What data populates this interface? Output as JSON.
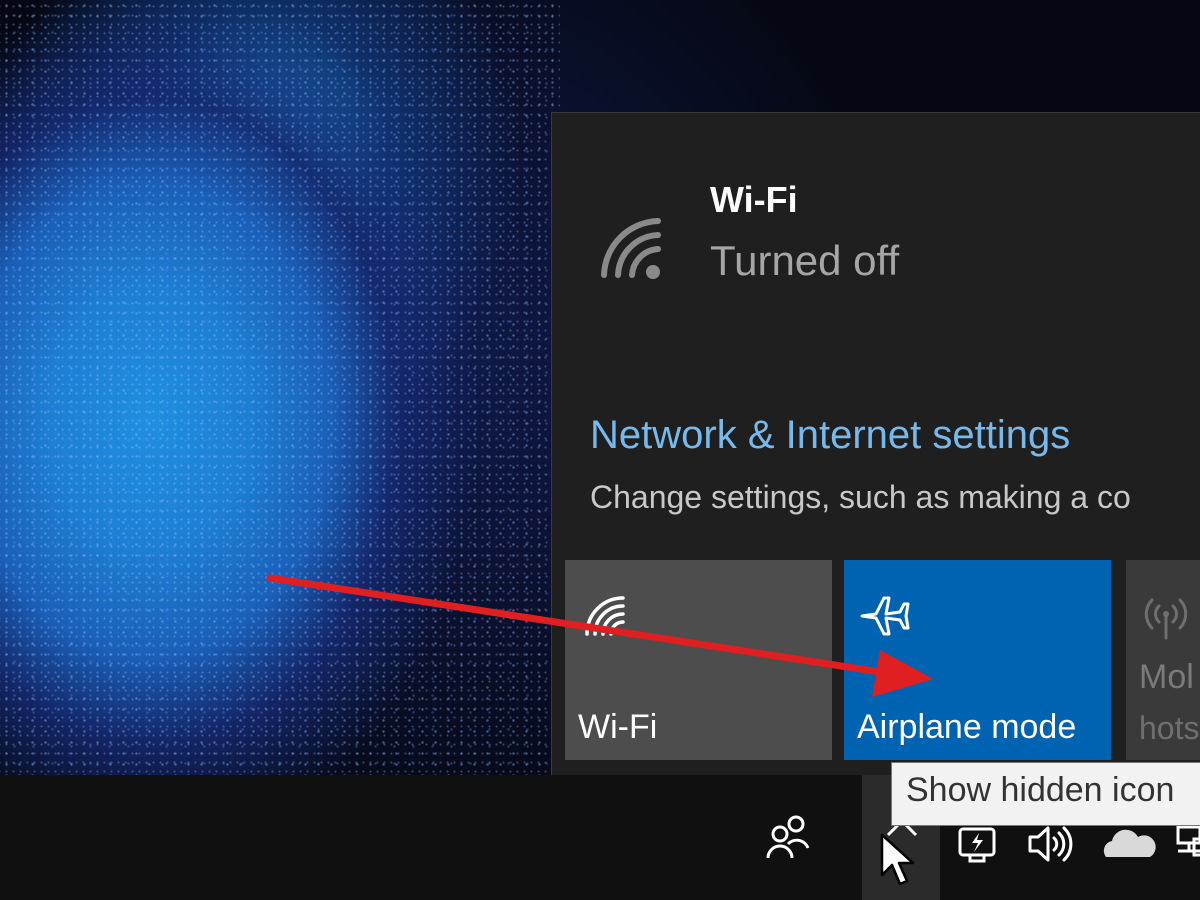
{
  "flyout": {
    "wifi": {
      "title": "Wi-Fi",
      "status": "Turned off",
      "icon": "wifi-off-icon"
    },
    "settings_link": "Network & Internet settings",
    "settings_description": "Change settings, such as making a co",
    "quick_actions": [
      {
        "label": "Wi-Fi",
        "icon": "wifi-icon",
        "state": "off"
      },
      {
        "label": "Airplane mode",
        "icon": "airplane-icon",
        "state": "on"
      },
      {
        "label": "Mol",
        "sublabel": "hots",
        "icon": "mobile-hotspot-icon",
        "state": "disabled"
      }
    ]
  },
  "taskbar": {
    "tooltip": "Show hidden icon",
    "icons": [
      "people-icon",
      "chevron-up-icon",
      "battery-icon",
      "volume-icon",
      "onedrive-icon",
      "network-icon"
    ]
  },
  "colors": {
    "flyout_bg": "#1f1f1f",
    "accent": "#0063b1",
    "link": "#76b9ed",
    "arrow": "#e02020"
  }
}
